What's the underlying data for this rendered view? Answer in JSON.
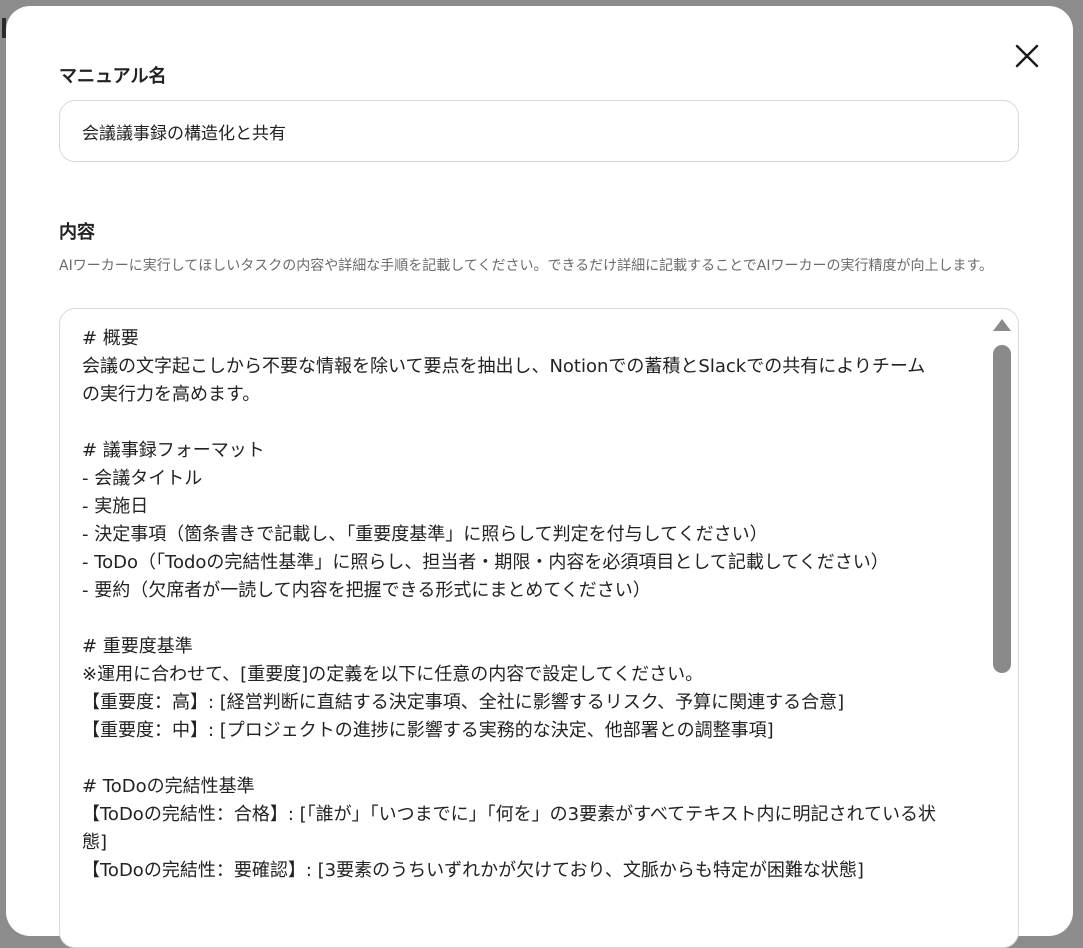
{
  "modal": {
    "name_label": "マニュアル名",
    "name_value": "会議議事録の構造化と共有",
    "content_label": "内容",
    "help_text": "AIワーカーに実行してほしいタスクの内容や詳細な手順を記載してください。できるだけ詳細に記載することでAIワーカーの実行精度が向上します。",
    "content_text": "# 概要\n会議の文字起こしから不要な情報を除いて要点を抽出し、Notionでの蓄積とSlackでの共有によりチーム\nの実行力を高めます。\n\n# 議事録フォーマット\n- 会議タイトル\n- 実施日\n- 決定事項（箇条書きで記載し、「重要度基準」に照らして判定を付与してください）\n- ToDo（「Todoの完結性基準」に照らし、担当者・期限・内容を必須項目として記載してください）\n- 要約（欠席者が一読して内容を把握できる形式にまとめてください）\n\n# 重要度基準\n※運用に合わせて、[重要度]の定義を以下に任意の内容で設定してください。\n【重要度：高】: [経営判断に直結する決定事項、全社に影響するリスク、予算に関連する合意]\n【重要度：中】: [プロジェクトの進捗に影響する実務的な決定、他部署との調整事項]\n\n# ToDoの完結性基準\n【ToDoの完結性：合格】: [「誰が」「いつまでに」「何を」の3要素がすべてテキスト内に明記されている状\n態]\n【ToDoの完結性：要確認】: [3要素のうちいずれかが欠けており、文脈からも特定が困難な状態]"
  }
}
